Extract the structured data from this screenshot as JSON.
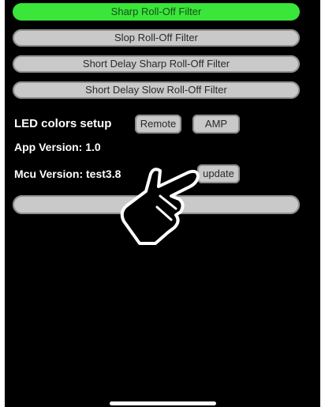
{
  "filters": [
    {
      "label": "Sharp Roll-Off Filter",
      "selected": true
    },
    {
      "label": "Slop Roll-Off Filter",
      "selected": false
    },
    {
      "label": "Short Delay Sharp Roll-Off Filter",
      "selected": false
    },
    {
      "label": "Short Delay Slow Roll-Off Filter",
      "selected": false
    }
  ],
  "led": {
    "label": "LED colors setup",
    "remote_label": "Remote",
    "amp_label": "AMP"
  },
  "app_version": "App Version: 1.0",
  "mcu": {
    "label": "Mcu Version: test3.8",
    "update_label": "update"
  },
  "colors": {
    "selected": "#39e639",
    "button": "#c9c9c9",
    "background": "#000000"
  },
  "overlay_icon": "pointing-hand-icon"
}
